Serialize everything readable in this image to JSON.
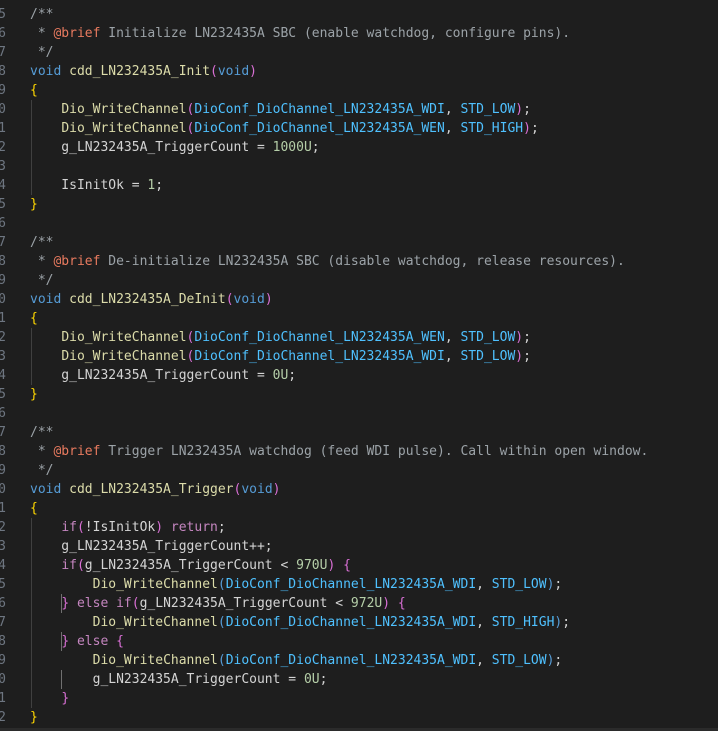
{
  "editor": {
    "lines": [
      {
        "n": "5",
        "tokens": [
          {
            "t": "/**",
            "c": "comment"
          }
        ]
      },
      {
        "n": "6",
        "tokens": [
          {
            "t": " * ",
            "c": "comment"
          },
          {
            "t": "@brief",
            "c": "tag"
          },
          {
            "t": " Initialize LN232435A SBC (enable watchdog, configure pins).",
            "c": "comment"
          }
        ]
      },
      {
        "n": "7",
        "tokens": [
          {
            "t": " */",
            "c": "comment"
          }
        ]
      },
      {
        "n": "8",
        "tokens": [
          {
            "t": "void",
            "c": "type"
          },
          {
            "t": " ",
            "c": "default"
          },
          {
            "t": "cdd_LN232435A_Init",
            "c": "func"
          },
          {
            "t": "(",
            "c": "brace2"
          },
          {
            "t": "void",
            "c": "type"
          },
          {
            "t": ")",
            "c": "brace2"
          }
        ]
      },
      {
        "n": "9",
        "tokens": [
          {
            "t": "{",
            "c": "brace1"
          }
        ]
      },
      {
        "n": "0",
        "tokens": [
          {
            "t": "    ",
            "c": "default"
          },
          {
            "t": "Dio_WriteChannel",
            "c": "func"
          },
          {
            "t": "(",
            "c": "brace2"
          },
          {
            "t": "DioConf_DioChannel_LN232435A_WDI",
            "c": "dioconst"
          },
          {
            "t": ", ",
            "c": "default"
          },
          {
            "t": "STD_LOW",
            "c": "stdconst"
          },
          {
            "t": ")",
            "c": "brace2"
          },
          {
            "t": ";",
            "c": "default"
          }
        ]
      },
      {
        "n": "1",
        "tokens": [
          {
            "t": "    ",
            "c": "default"
          },
          {
            "t": "Dio_WriteChannel",
            "c": "func"
          },
          {
            "t": "(",
            "c": "brace2"
          },
          {
            "t": "DioConf_DioChannel_LN232435A_WEN",
            "c": "dioconst"
          },
          {
            "t": ", ",
            "c": "default"
          },
          {
            "t": "STD_HIGH",
            "c": "stdconst"
          },
          {
            "t": ")",
            "c": "brace2"
          },
          {
            "t": ";",
            "c": "default"
          }
        ]
      },
      {
        "n": "2",
        "tokens": [
          {
            "t": "    g_LN232435A_TriggerCount = ",
            "c": "default"
          },
          {
            "t": "1000U",
            "c": "number"
          },
          {
            "t": ";",
            "c": "default"
          }
        ]
      },
      {
        "n": "3",
        "tokens": []
      },
      {
        "n": "4",
        "tokens": [
          {
            "t": "    IsInitOk = ",
            "c": "default"
          },
          {
            "t": "1",
            "c": "number"
          },
          {
            "t": ";",
            "c": "default"
          }
        ]
      },
      {
        "n": "5",
        "tokens": [
          {
            "t": "}",
            "c": "brace1"
          }
        ]
      },
      {
        "n": "6",
        "tokens": []
      },
      {
        "n": "7",
        "tokens": [
          {
            "t": "/**",
            "c": "comment"
          }
        ]
      },
      {
        "n": "8",
        "tokens": [
          {
            "t": " * ",
            "c": "comment"
          },
          {
            "t": "@brief",
            "c": "tag"
          },
          {
            "t": " De-initialize LN232435A SBC (disable watchdog, release resources).",
            "c": "comment"
          }
        ]
      },
      {
        "n": "9",
        "tokens": [
          {
            "t": " */",
            "c": "comment"
          }
        ]
      },
      {
        "n": "0",
        "tokens": [
          {
            "t": "void",
            "c": "type"
          },
          {
            "t": " ",
            "c": "default"
          },
          {
            "t": "cdd_LN232435A_DeInit",
            "c": "func"
          },
          {
            "t": "(",
            "c": "brace2"
          },
          {
            "t": "void",
            "c": "type"
          },
          {
            "t": ")",
            "c": "brace2"
          }
        ]
      },
      {
        "n": "1",
        "tokens": [
          {
            "t": "{",
            "c": "brace1"
          }
        ]
      },
      {
        "n": "2",
        "tokens": [
          {
            "t": "    ",
            "c": "default"
          },
          {
            "t": "Dio_WriteChannel",
            "c": "func"
          },
          {
            "t": "(",
            "c": "brace2"
          },
          {
            "t": "DioConf_DioChannel_LN232435A_WEN",
            "c": "dioconst"
          },
          {
            "t": ", ",
            "c": "default"
          },
          {
            "t": "STD_LOW",
            "c": "stdconst"
          },
          {
            "t": ")",
            "c": "brace2"
          },
          {
            "t": ";",
            "c": "default"
          }
        ]
      },
      {
        "n": "3",
        "tokens": [
          {
            "t": "    ",
            "c": "default"
          },
          {
            "t": "Dio_WriteChannel",
            "c": "func"
          },
          {
            "t": "(",
            "c": "brace2"
          },
          {
            "t": "DioConf_DioChannel_LN232435A_WDI",
            "c": "dioconst"
          },
          {
            "t": ", ",
            "c": "default"
          },
          {
            "t": "STD_LOW",
            "c": "stdconst"
          },
          {
            "t": ")",
            "c": "brace2"
          },
          {
            "t": ";",
            "c": "default"
          }
        ]
      },
      {
        "n": "4",
        "tokens": [
          {
            "t": "    g_LN232435A_TriggerCount = ",
            "c": "default"
          },
          {
            "t": "0U",
            "c": "number"
          },
          {
            "t": ";",
            "c": "default"
          }
        ]
      },
      {
        "n": "5",
        "tokens": [
          {
            "t": "}",
            "c": "brace1"
          }
        ]
      },
      {
        "n": "6",
        "tokens": []
      },
      {
        "n": "7",
        "tokens": [
          {
            "t": "/**",
            "c": "comment"
          }
        ]
      },
      {
        "n": "8",
        "tokens": [
          {
            "t": " * ",
            "c": "comment"
          },
          {
            "t": "@brief",
            "c": "tag"
          },
          {
            "t": " Trigger LN232435A watchdog (feed WDI pulse). Call within open window.",
            "c": "comment"
          }
        ]
      },
      {
        "n": "9",
        "tokens": [
          {
            "t": " */",
            "c": "comment"
          }
        ]
      },
      {
        "n": "0",
        "tokens": [
          {
            "t": "void",
            "c": "type"
          },
          {
            "t": " ",
            "c": "default"
          },
          {
            "t": "cdd_LN232435A_Trigger",
            "c": "func"
          },
          {
            "t": "(",
            "c": "brace2"
          },
          {
            "t": "void",
            "c": "type"
          },
          {
            "t": ")",
            "c": "brace2"
          }
        ]
      },
      {
        "n": "1",
        "tokens": [
          {
            "t": "{",
            "c": "brace1"
          }
        ]
      },
      {
        "n": "2",
        "tokens": [
          {
            "t": "    ",
            "c": "default"
          },
          {
            "t": "if",
            "c": "keyword"
          },
          {
            "t": "(",
            "c": "brace2"
          },
          {
            "t": "!IsInitOk",
            "c": "default"
          },
          {
            "t": ")",
            "c": "brace2"
          },
          {
            "t": " ",
            "c": "default"
          },
          {
            "t": "return",
            "c": "keyword"
          },
          {
            "t": ";",
            "c": "default"
          }
        ]
      },
      {
        "n": "3",
        "tokens": [
          {
            "t": "    g_LN232435A_TriggerCount++;",
            "c": "default"
          }
        ]
      },
      {
        "n": "4",
        "tokens": [
          {
            "t": "    ",
            "c": "default"
          },
          {
            "t": "if",
            "c": "keyword"
          },
          {
            "t": "(",
            "c": "brace2"
          },
          {
            "t": "g_LN232435A_TriggerCount < ",
            "c": "default"
          },
          {
            "t": "970U",
            "c": "number"
          },
          {
            "t": ")",
            "c": "brace2"
          },
          {
            "t": " ",
            "c": "default"
          },
          {
            "t": "{",
            "c": "brace2"
          }
        ]
      },
      {
        "n": "5",
        "tokens": [
          {
            "t": "        ",
            "c": "default"
          },
          {
            "t": "Dio_WriteChannel",
            "c": "func"
          },
          {
            "t": "(",
            "c": "type"
          },
          {
            "t": "DioConf_DioChannel_LN232435A_WDI",
            "c": "dioconst"
          },
          {
            "t": ", ",
            "c": "default"
          },
          {
            "t": "STD_LOW",
            "c": "stdconst"
          },
          {
            "t": ")",
            "c": "type"
          },
          {
            "t": ";",
            "c": "default"
          }
        ]
      },
      {
        "n": "6",
        "tokens": [
          {
            "t": "    ",
            "c": "default"
          },
          {
            "t": "}",
            "c": "brace2"
          },
          {
            "t": " ",
            "c": "default"
          },
          {
            "t": "else",
            "c": "keyword"
          },
          {
            "t": " ",
            "c": "default"
          },
          {
            "t": "if",
            "c": "keyword"
          },
          {
            "t": "(",
            "c": "brace2"
          },
          {
            "t": "g_LN232435A_TriggerCount < ",
            "c": "default"
          },
          {
            "t": "972U",
            "c": "number"
          },
          {
            "t": ")",
            "c": "brace2"
          },
          {
            "t": " ",
            "c": "default"
          },
          {
            "t": "{",
            "c": "brace2"
          }
        ]
      },
      {
        "n": "7",
        "tokens": [
          {
            "t": "        ",
            "c": "default"
          },
          {
            "t": "Dio_WriteChannel",
            "c": "func"
          },
          {
            "t": "(",
            "c": "type"
          },
          {
            "t": "DioConf_DioChannel_LN232435A_WDI",
            "c": "dioconst"
          },
          {
            "t": ", ",
            "c": "default"
          },
          {
            "t": "STD_HIGH",
            "c": "stdconst"
          },
          {
            "t": ")",
            "c": "type"
          },
          {
            "t": ";",
            "c": "default"
          }
        ]
      },
      {
        "n": "8",
        "tokens": [
          {
            "t": "    ",
            "c": "default"
          },
          {
            "t": "}",
            "c": "brace2"
          },
          {
            "t": " ",
            "c": "default"
          },
          {
            "t": "else",
            "c": "keyword"
          },
          {
            "t": " ",
            "c": "default"
          },
          {
            "t": "{",
            "c": "brace2"
          }
        ]
      },
      {
        "n": "9",
        "tokens": [
          {
            "t": "        ",
            "c": "default"
          },
          {
            "t": "Dio_WriteChannel",
            "c": "func"
          },
          {
            "t": "(",
            "c": "type"
          },
          {
            "t": "DioConf_DioChannel_LN232435A_WDI",
            "c": "dioconst"
          },
          {
            "t": ", ",
            "c": "default"
          },
          {
            "t": "STD_LOW",
            "c": "stdconst"
          },
          {
            "t": ")",
            "c": "type"
          },
          {
            "t": ";",
            "c": "default"
          }
        ]
      },
      {
        "n": "0",
        "tokens": [
          {
            "t": "        g_LN232435A_TriggerCount = ",
            "c": "default"
          },
          {
            "t": "0U",
            "c": "number"
          },
          {
            "t": ";",
            "c": "default"
          }
        ]
      },
      {
        "n": "1",
        "tokens": [
          {
            "t": "    ",
            "c": "default"
          },
          {
            "t": "}",
            "c": "brace2"
          }
        ]
      },
      {
        "n": "2",
        "tokens": [
          {
            "t": "}",
            "c": "brace1"
          }
        ]
      }
    ]
  },
  "colors": {
    "background": "#1e1e1e",
    "comment": "#9ca3a8",
    "tag": "#e87a5f",
    "keyword": "#c586c0",
    "type": "#569cd6",
    "func": "#dcdcaa",
    "constant": "#4fc1ff",
    "number": "#b5cea8",
    "brace_gold": "#ffd700",
    "brace_orchid": "#da70d6"
  }
}
